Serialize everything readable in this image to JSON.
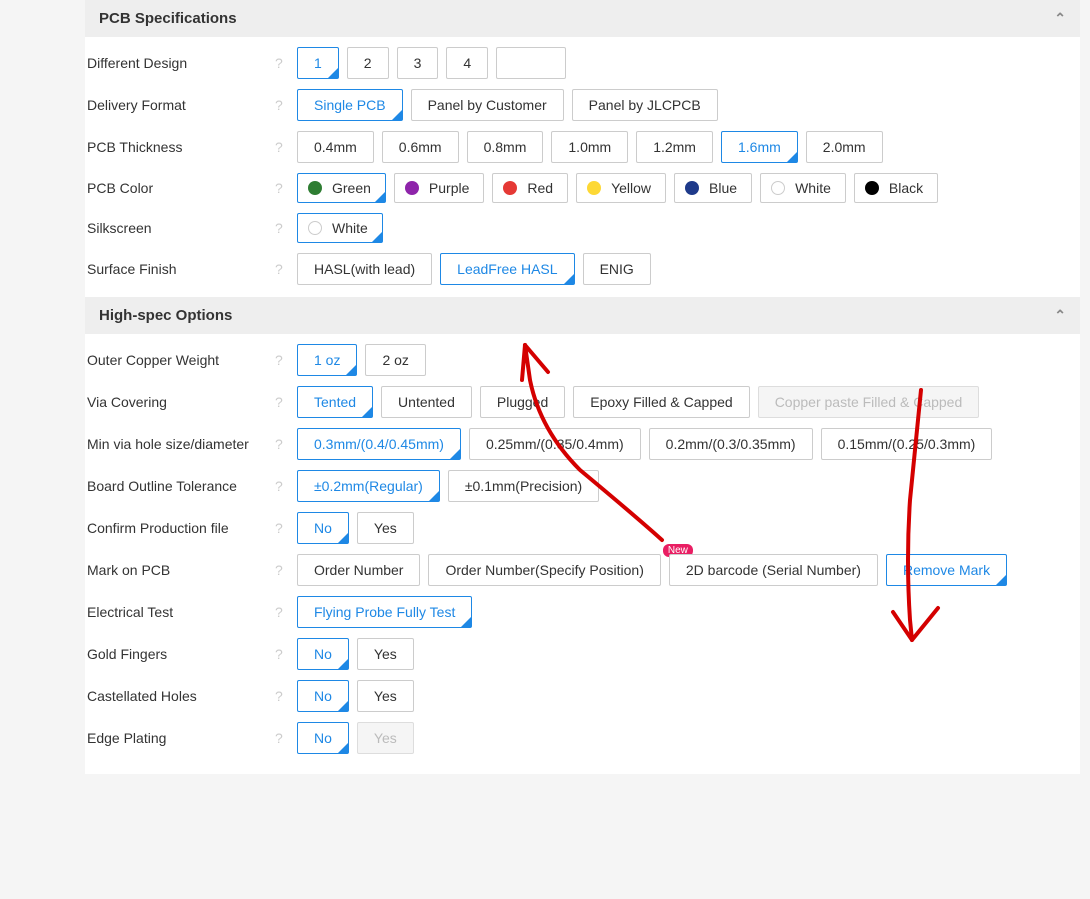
{
  "sections": {
    "pcbSpec": "PCB Specifications",
    "highSpec": "High-spec Options"
  },
  "diffDesign": {
    "label": "Different Design",
    "opts": [
      "1",
      "2",
      "3",
      "4"
    ],
    "sel": "1"
  },
  "deliveryFormat": {
    "label": "Delivery Format",
    "opts": [
      "Single PCB",
      "Panel by Customer",
      "Panel by JLCPCB"
    ],
    "sel": "Single PCB"
  },
  "thickness": {
    "label": "PCB Thickness",
    "opts": [
      "0.4mm",
      "0.6mm",
      "0.8mm",
      "1.0mm",
      "1.2mm",
      "1.6mm",
      "2.0mm"
    ],
    "sel": "1.6mm"
  },
  "color": {
    "label": "PCB Color",
    "sel": "Green",
    "opts": [
      {
        "name": "Green",
        "hex": "#2e7d32"
      },
      {
        "name": "Purple",
        "hex": "#8e24aa"
      },
      {
        "name": "Red",
        "hex": "#e53935"
      },
      {
        "name": "Yellow",
        "hex": "#fdd835"
      },
      {
        "name": "Blue",
        "hex": "#1e3a8a"
      },
      {
        "name": "White",
        "hex": "#ffffff",
        "hollow": true
      },
      {
        "name": "Black",
        "hex": "#000000"
      }
    ]
  },
  "silk": {
    "label": "Silkscreen",
    "opts": [
      {
        "name": "White",
        "hex": "#ffffff",
        "hollow": true
      }
    ],
    "sel": "White"
  },
  "surface": {
    "label": "Surface Finish",
    "opts": [
      "HASL(with lead)",
      "LeadFree HASL",
      "ENIG"
    ],
    "sel": "LeadFree HASL"
  },
  "copper": {
    "label": "Outer Copper Weight",
    "opts": [
      "1 oz",
      "2 oz"
    ],
    "sel": "1 oz"
  },
  "via": {
    "label": "Via Covering",
    "opts": [
      "Tented",
      "Untented",
      "Plugged",
      "Epoxy Filled & Capped",
      "Copper paste Filled & Capped"
    ],
    "sel": "Tented",
    "disabled": [
      "Copper paste Filled & Capped"
    ]
  },
  "minvia": {
    "label": "Min via hole size/diameter",
    "opts": [
      "0.3mm/(0.4/0.45mm)",
      "0.25mm/(0.35/0.4mm)",
      "0.2mm/(0.3/0.35mm)",
      "0.15mm/(0.25/0.3mm)"
    ],
    "sel": "0.3mm/(0.4/0.45mm)"
  },
  "tol": {
    "label": "Board Outline Tolerance",
    "opts": [
      "±0.2mm(Regular)",
      "±0.1mm(Precision)"
    ],
    "sel": "±0.2mm(Regular)"
  },
  "confirm": {
    "label": "Confirm Production file",
    "opts": [
      "No",
      "Yes"
    ],
    "sel": "No"
  },
  "mark": {
    "label": "Mark on PCB",
    "opts": [
      "Order Number",
      "Order Number(Specify Position)",
      "2D barcode (Serial Number)",
      "Remove Mark"
    ],
    "sel": "Remove Mark",
    "badge": "New",
    "badgeOn": "2D barcode (Serial Number)"
  },
  "etest": {
    "label": "Electrical Test",
    "opts": [
      "Flying Probe Fully Test"
    ],
    "sel": "Flying Probe Fully Test"
  },
  "gold": {
    "label": "Gold Fingers",
    "opts": [
      "No",
      "Yes"
    ],
    "sel": "No"
  },
  "cast": {
    "label": "Castellated Holes",
    "opts": [
      "No",
      "Yes"
    ],
    "sel": "No"
  },
  "edge": {
    "label": "Edge Plating",
    "opts": [
      "No",
      "Yes"
    ],
    "sel": "No",
    "disabled": [
      "Yes"
    ]
  }
}
